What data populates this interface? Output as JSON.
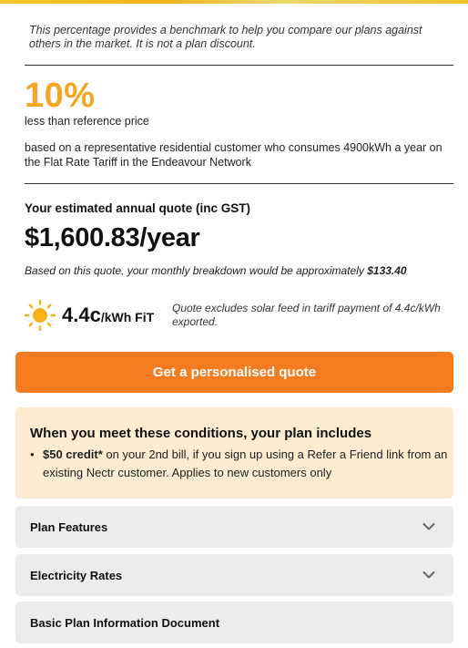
{
  "benchmark": {
    "note": "This percentage provides a benchmark to help you compare our plans against others in the market. It is not a plan discount.",
    "percent": "10%",
    "percent_label": "less than reference price",
    "description": "based on a representative residential customer who consumes 4900kWh a year on the Flat Rate Tariff in the Endeavour Network"
  },
  "quote": {
    "heading": "Your estimated annual quote (inc GST)",
    "price": "$1,600.83/year",
    "monthly_prefix": "Based on this quote, your monthly breakdown would be approximately ",
    "monthly_amount": "$133.40"
  },
  "fit": {
    "icon": "sun-icon",
    "rate": "4.4c",
    "unit": "/kWh FiT",
    "note": "Quote excludes solar feed in tariff payment of 4.4c/kWh exported."
  },
  "cta": {
    "label": "Get a personalised quote"
  },
  "conditions": {
    "title": "When you meet these conditions, your plan includes",
    "bullet": "•",
    "item_bold": "$50 credit*",
    "item_text": " on your 2nd bill, if you sign up using a Refer a Friend link from an existing Nectr customer. Applies to new customers only"
  },
  "accordions": [
    {
      "label": "Plan Features",
      "icon": "chevron-down-icon"
    },
    {
      "label": "Electricity Rates",
      "icon": "chevron-down-icon"
    },
    {
      "label": "Basic Plan Information Document"
    }
  ],
  "colors": {
    "accent_orange": "#f47b20",
    "percent_yellow": "#f5a623",
    "conditions_bg": "#fdecd1",
    "accordion_bg": "#ececec"
  }
}
